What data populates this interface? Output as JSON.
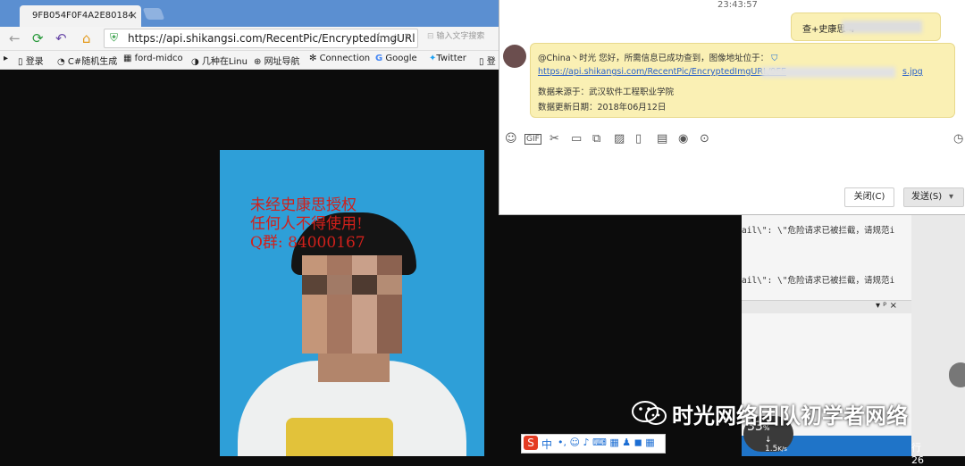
{
  "browser": {
    "tab_title": "9FB054F0F4A2E80184",
    "tab_close": "×",
    "url": "https://api.shikangsi.com/RecentPic/EncryptedImgURl",
    "search_placeholder": "输入文字搜索",
    "bookmarks": [
      "登录",
      "C#随机生成",
      "ford-midco",
      "几种在Linu",
      "网址导航",
      "Connection",
      "Google",
      "Twitter",
      "登"
    ]
  },
  "photo": {
    "watermark_line1": "未经史康思授权",
    "watermark_line2": "任何人不得使用!",
    "watermark_line3": "Q群: 84000167"
  },
  "ime": {
    "logo": "S",
    "mode": "中"
  },
  "code_panel": {
    "line1": "ail\\\": \\\"危险请求已被拦截，请规范i",
    "line2": "ail\\\": \\\"危险请求已被拦截，请规范i",
    "status_line": "行 26",
    "panel_icons": "▾ ᵖ ×"
  },
  "speed": {
    "percent": "33",
    "percent_unit": "%",
    "rate": "1.5",
    "rate_unit": "K/s"
  },
  "chat": {
    "time": "23:43:57",
    "sent_message": "查+史康思-4",
    "received_line1": "@China丶时光 您好，所需信息已成功查到，图像地址位于：",
    "received_link": "https://api.shikangsi.com/RecentPic/EncryptedImgURL/9FE",
    "received_link_suffix": "s.jpg",
    "received_line3": "数据来源于：武汉软件工程职业学院",
    "received_line4": "数据更新日期：2018年06月12日",
    "close_button": "关闭(C)",
    "send_button": "发送(S)"
  },
  "footer": {
    "brand": "时光网络团队初学者网络"
  }
}
